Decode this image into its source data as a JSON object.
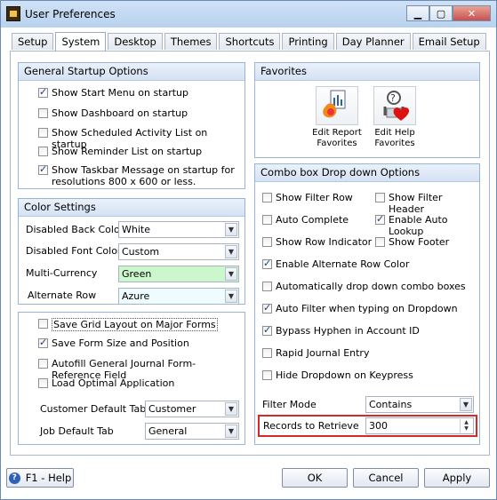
{
  "window": {
    "title": "User Preferences"
  },
  "tabs": [
    "Setup",
    "System",
    "Desktop",
    "Themes",
    "Shortcuts",
    "Printing",
    "Day Planner",
    "Email Setup"
  ],
  "startup": {
    "title": "General Startup Options",
    "items": [
      {
        "label": "Show Start Menu on startup",
        "checked": true
      },
      {
        "label": "Show Dashboard on startup",
        "checked": false
      },
      {
        "label": "Show Scheduled Activity List on startup",
        "checked": false
      },
      {
        "label": "Show Reminder List on startup",
        "checked": false
      },
      {
        "label": "Show Taskbar Message on startup for",
        "label2": "resolutions 800 x 600 or less.",
        "checked": true
      }
    ]
  },
  "color": {
    "title": "Color Settings",
    "rows": [
      {
        "label": "Disabled Back Color",
        "value": "White"
      },
      {
        "label": "Disabled Font Color",
        "value": "Custom"
      },
      {
        "label": "Multi-Currency",
        "value": "Green"
      },
      {
        "label": "Alternate Row",
        "value": "Azure"
      }
    ]
  },
  "misc": {
    "items": [
      {
        "label": "Save Grid Layout on Major Forms",
        "checked": false
      },
      {
        "label": "Save Form Size and Position",
        "checked": true
      },
      {
        "label": "Autofill General Journal Form-Reference Field",
        "checked": false
      },
      {
        "label": "Load Optimal Application",
        "checked": false
      }
    ],
    "customer_tab_label": "Customer Default Tab",
    "customer_tab_value": "Customer",
    "job_tab_label": "Job Default Tab",
    "job_tab_value": "General"
  },
  "favorites": {
    "title": "Favorites",
    "report_label_1": "Edit Report",
    "report_label_2": "Favorites",
    "help_label_1": "Edit Help",
    "help_label_2": "Favorites"
  },
  "combo": {
    "title": "Combo box Drop down Options",
    "pairs": [
      {
        "left": "Show Filter Row",
        "left_checked": false,
        "right": "Show Filter Header",
        "right_checked": false
      },
      {
        "left": "Auto Complete",
        "left_checked": false,
        "right": "Enable Auto Lookup",
        "right_checked": true
      },
      {
        "left": "Show Row Indicator",
        "left_checked": false,
        "right": "Show Footer",
        "right_checked": false
      }
    ],
    "singles": [
      {
        "label": "Enable Alternate Row Color",
        "checked": true
      },
      {
        "label": "Automatically drop down combo boxes",
        "checked": false
      },
      {
        "label": "Auto Filter when typing on Dropdown",
        "checked": true
      },
      {
        "label": "Bypass Hyphen in Account ID",
        "checked": true
      },
      {
        "label": "Rapid Journal Entry",
        "checked": false
      },
      {
        "label": "Hide Dropdown on Keypress",
        "checked": false
      }
    ],
    "filter_mode_label": "Filter Mode",
    "filter_mode_value": "Contains",
    "records_label": "Records to Retrieve",
    "records_value": "300"
  },
  "footer": {
    "help": "F1 - Help",
    "ok": "OK",
    "cancel": "Cancel",
    "apply": "Apply"
  }
}
